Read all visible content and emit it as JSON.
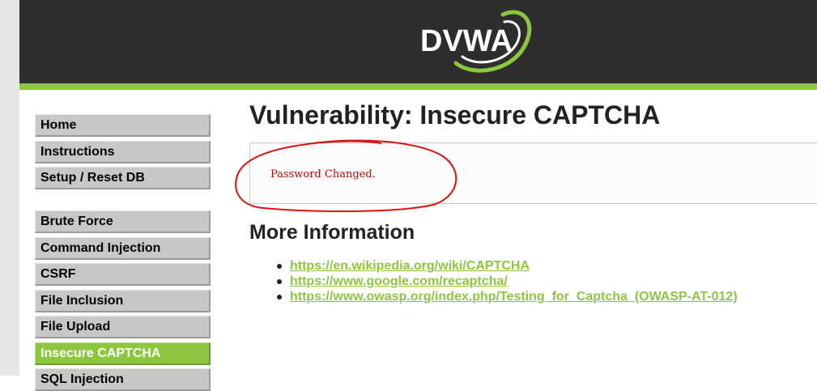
{
  "header": {
    "logo_text": "DVWA",
    "accent_color": "#8dc63f",
    "background_color": "#2e2e2e"
  },
  "menu": {
    "items": [
      {
        "label": "Home",
        "selected": false
      },
      {
        "label": "Instructions",
        "selected": false
      },
      {
        "label": "Setup / Reset DB",
        "selected": false
      },
      {
        "label": "Brute Force",
        "selected": false
      },
      {
        "label": "Command Injection",
        "selected": false
      },
      {
        "label": "CSRF",
        "selected": false
      },
      {
        "label": "File Inclusion",
        "selected": false
      },
      {
        "label": "File Upload",
        "selected": false
      },
      {
        "label": "Insecure CAPTCHA",
        "selected": true
      },
      {
        "label": "SQL Injection",
        "selected": false
      }
    ]
  },
  "main": {
    "title": "Vulnerability: Insecure CAPTCHA",
    "result_message": "Password Changed.",
    "annotation_color": "#e01010",
    "more_info": {
      "heading": "More Information",
      "links": [
        "https://en.wikipedia.org/wiki/CAPTCHA",
        "https://www.google.com/recaptcha/",
        "https://www.owasp.org/index.php/Testing_for_Captcha_(OWASP-AT-012)"
      ]
    }
  }
}
